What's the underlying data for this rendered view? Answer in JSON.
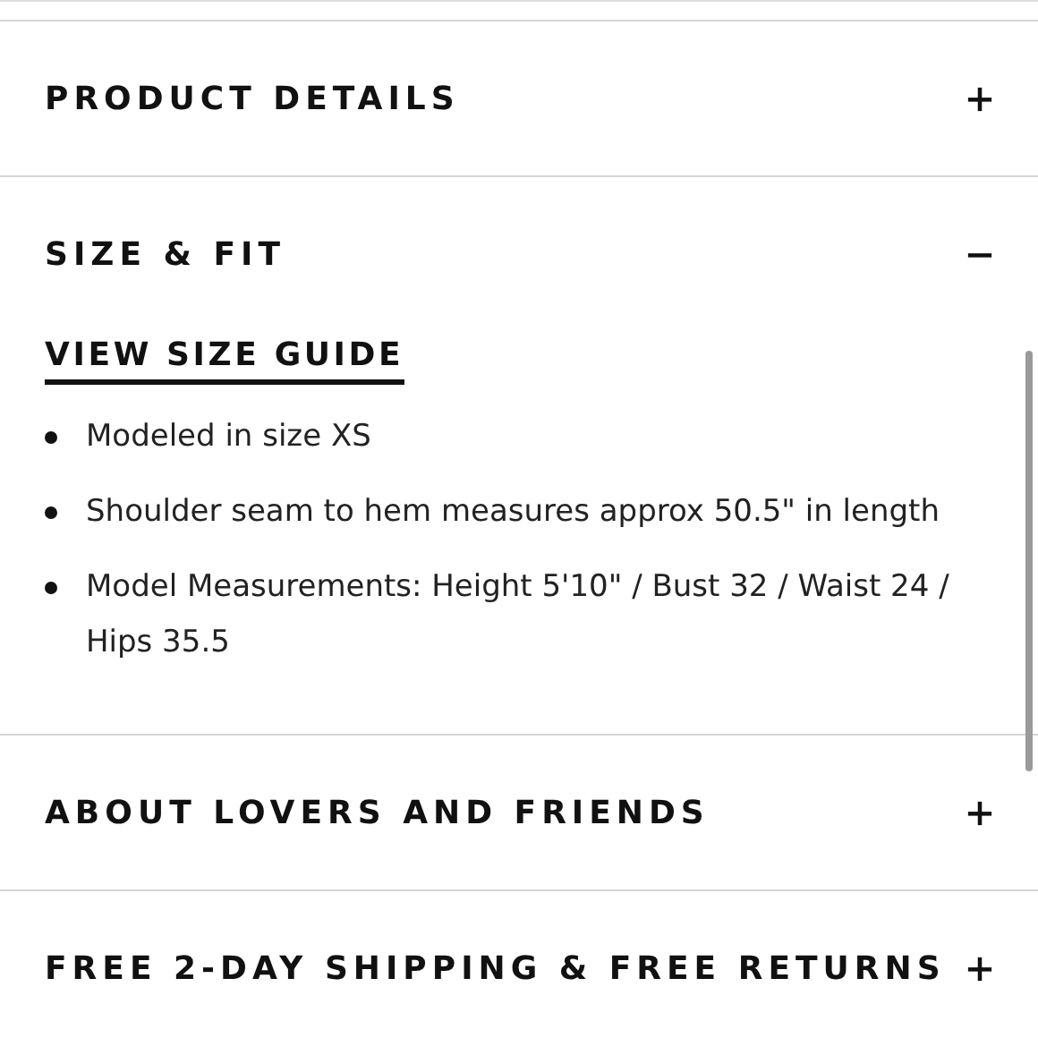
{
  "sections": [
    {
      "title": "PRODUCT DETAILS",
      "expanded": false
    },
    {
      "title": "SIZE & FIT",
      "expanded": true,
      "link": "VIEW SIZE GUIDE",
      "bullets": [
        "Modeled in size XS",
        "Shoulder seam to hem measures approx 50.5\" in length",
        "Model Measurements: Height 5'10\" / Bust 32 / Waist 24 / Hips 35.5"
      ]
    },
    {
      "title": "ABOUT LOVERS AND FRIENDS",
      "expanded": false
    },
    {
      "title": "FREE 2-DAY SHIPPING & FREE RETURNS",
      "expanded": false
    }
  ]
}
